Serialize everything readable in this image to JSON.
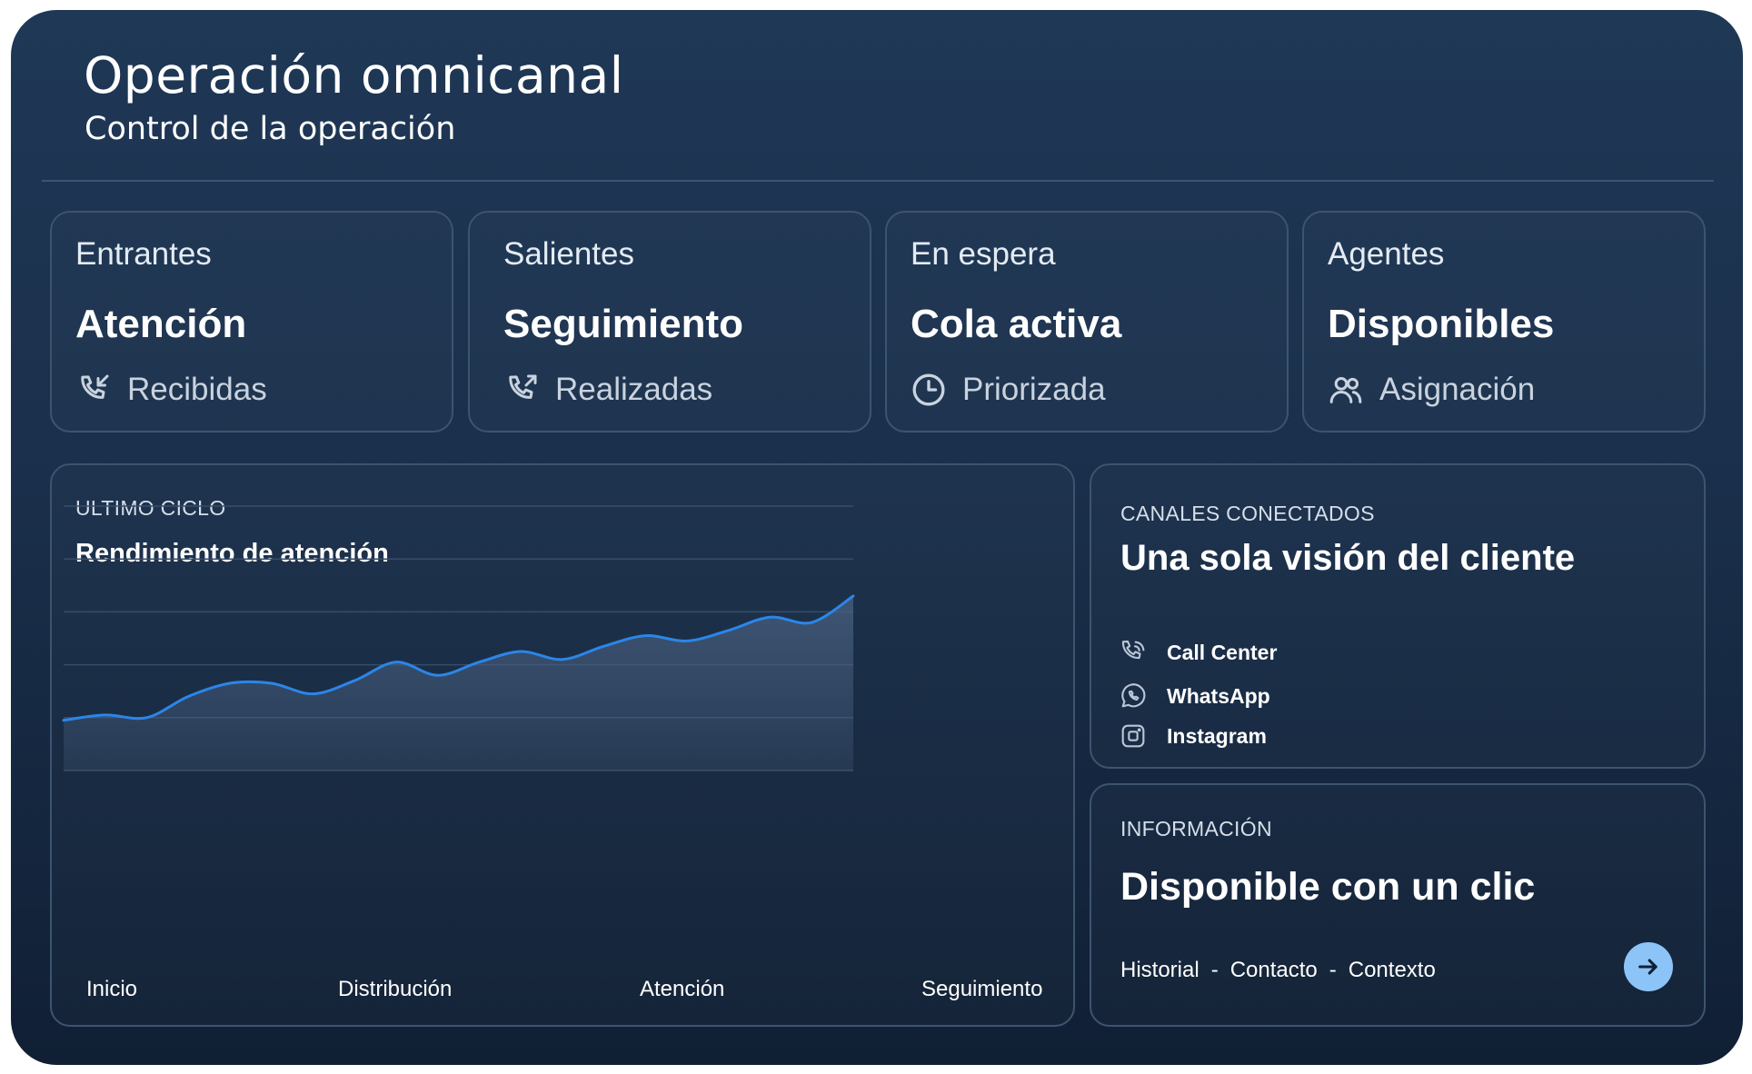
{
  "header": {
    "title": "Operación omnicanal",
    "subtitle": "Control de la operación"
  },
  "stats": [
    {
      "category": "Entrantes",
      "title": "Atención",
      "sub": "Recibidas",
      "icon": "phone-incoming-icon"
    },
    {
      "category": "Salientes",
      "title": "Seguimiento",
      "sub": "Realizadas",
      "icon": "phone-outgoing-icon"
    },
    {
      "category": "En espera",
      "title": "Cola activa",
      "sub": "Priorizada",
      "icon": "clock-icon"
    },
    {
      "category": "Agentes",
      "title": "Disponibles",
      "sub": "Asignación",
      "icon": "users-icon"
    }
  ],
  "chart_card": {
    "eyebrow": "ULTIMO CICLO",
    "title": "Rendimiento de atención"
  },
  "chart_data": {
    "type": "area",
    "x_labels": [
      "Inicio",
      "Distribución",
      "Atención",
      "Seguimiento"
    ],
    "values": [
      0.19,
      0.21,
      0.2,
      0.28,
      0.33,
      0.33,
      0.29,
      0.34,
      0.41,
      0.36,
      0.41,
      0.45,
      0.42,
      0.47,
      0.51,
      0.49,
      0.53,
      0.58,
      0.56,
      0.66
    ],
    "grid": true,
    "line_color": "#2b86e8",
    "fill_color": "#4a6282"
  },
  "channels_card": {
    "eyebrow": "CANALES CONECTADOS",
    "title": "Una sola visión del cliente",
    "items": [
      {
        "label": "Call Center",
        "icon": "phone-icon"
      },
      {
        "label": "WhatsApp",
        "icon": "whatsapp-icon"
      },
      {
        "label": "Instagram",
        "icon": "instagram-icon"
      }
    ]
  },
  "info_card": {
    "eyebrow": "INFORMACIÓN",
    "title": "Disponible con un clic",
    "links": [
      "Historial",
      "Contacto",
      "Contexto"
    ],
    "separator": "-",
    "button_icon": "arrow-right-icon"
  },
  "colors": {
    "accent": "#8dc4f7",
    "line": "#2b86e8"
  }
}
